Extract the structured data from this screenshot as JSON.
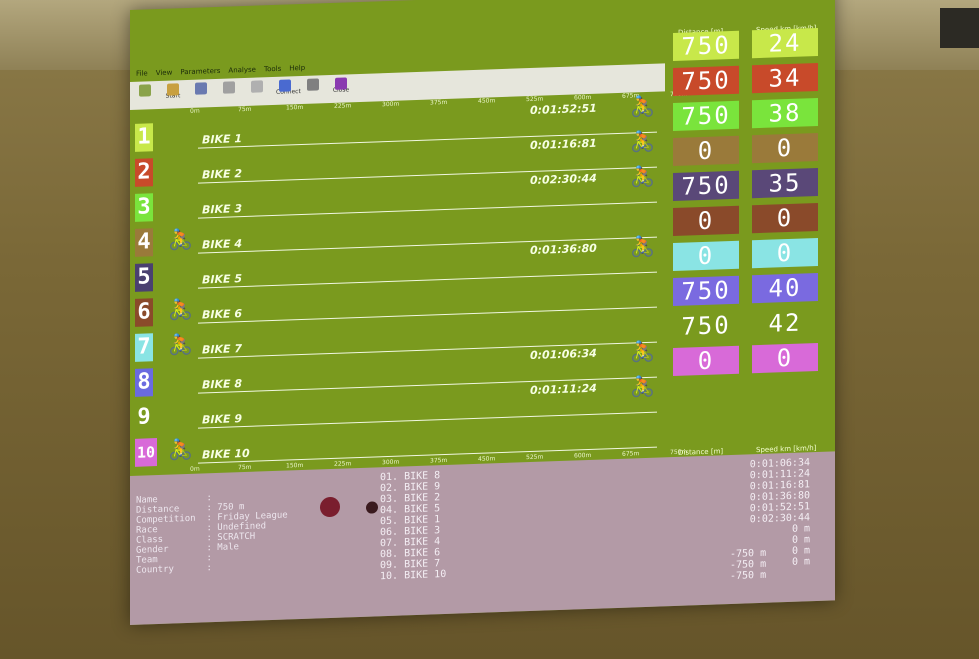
{
  "menu": [
    "File",
    "View",
    "Parameters",
    "Analyse",
    "Tools",
    "Help"
  ],
  "toolbar": {
    "buttons": [
      {
        "label": ""
      },
      {
        "label": "Start"
      },
      {
        "label": ""
      },
      {
        "label": ""
      },
      {
        "label": ""
      },
      {
        "label": "Connect"
      },
      {
        "label": ""
      },
      {
        "label": "Close"
      }
    ]
  },
  "scale": [
    "0m",
    "75m",
    "150m",
    "225m",
    "300m",
    "375m",
    "450m",
    "525m",
    "600m",
    "675m",
    "750m"
  ],
  "headers": {
    "distance": "Distance [m]",
    "speed": "Speed km [km/h]"
  },
  "lanes": [
    {
      "num": "1",
      "label": "BIKE 1",
      "time": "0:01:52:51",
      "color": "#c8e84a",
      "dist": "750",
      "speed": "24",
      "dcol": "#c8e84a",
      "rider": true
    },
    {
      "num": "2",
      "label": "BIKE 2",
      "time": "0:01:16:81",
      "color": "#c84a2a",
      "dist": "750",
      "speed": "34",
      "dcol": "#c84a2a",
      "rider": true
    },
    {
      "num": "3",
      "label": "BIKE 3",
      "time": "0:02:30:44",
      "color": "#7ae43c",
      "dist": "750",
      "speed": "38",
      "dcol": "#7ae43c",
      "rider": true
    },
    {
      "num": "4",
      "label": "BIKE 4",
      "time": "",
      "color": "#9a7a3a",
      "dist": "0",
      "speed": "0",
      "dcol": "#9a7a3a",
      "rider": true
    },
    {
      "num": "5",
      "label": "BIKE 5",
      "time": "0:01:36:80",
      "color": "#4a4070",
      "dist": "750",
      "speed": "35",
      "dcol": "#5a4878",
      "rider": true
    },
    {
      "num": "6",
      "label": "BIKE 6",
      "time": "",
      "color": "#8a4a2a",
      "dist": "0",
      "speed": "0",
      "dcol": "#8a4a2a",
      "rider": true
    },
    {
      "num": "7",
      "label": "BIKE 7",
      "time": "",
      "color": "#8ae4e4",
      "dist": "0",
      "speed": "0",
      "dcol": "#8ae4e4",
      "rider": true
    },
    {
      "num": "8",
      "label": "BIKE 8",
      "time": "0:01:06:34",
      "color": "#6a6ae0",
      "dist": "750",
      "speed": "40",
      "dcol": "#7a6ae0",
      "rider": true
    },
    {
      "num": "9",
      "label": "BIKE 9",
      "time": "0:01:11:24",
      "color": "#7a9a1e",
      "dist": "750",
      "speed": "42",
      "dcol": "#7a9a1e",
      "rider": true
    },
    {
      "num": "10",
      "label": "BIKE 10",
      "time": "",
      "color": "#d86ad8",
      "dist": "0",
      "speed": "0",
      "dcol": "#d86ad8",
      "rider": true
    }
  ],
  "info": [
    "Name         :",
    "Distance     : 750 m",
    "Competition  : Friday League",
    "Race         : Undefined",
    "Class        : SCRATCH",
    "Gender       : Male",
    "Team         :",
    "Country      :"
  ],
  "ranks": [
    "01. BIKE 8",
    "02. BIKE 9",
    "03. BIKE 2",
    "04. BIKE 5",
    "05. BIKE 1",
    "06. BIKE 3",
    "07. BIKE 4",
    "08. BIKE 6",
    "09. BIKE 7",
    "10. BIKE 10"
  ],
  "results": [
    "0:01:06:34",
    "0:01:11:24",
    "0:01:16:81",
    "0:01:36:80",
    "0:01:52:51",
    "0:02:30:44",
    "0 m",
    "0 m",
    "0 m",
    "0 m"
  ],
  "gaps": [
    "-750 m",
    "-750 m",
    "-750 m"
  ]
}
